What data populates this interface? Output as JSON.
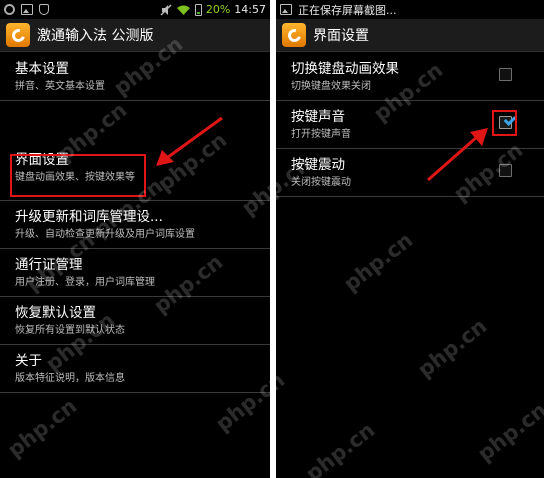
{
  "left_screen": {
    "status_bar": {
      "battery_percent": "20%",
      "time": "14:57"
    },
    "title": "激通输入法 公测版",
    "menu_items": [
      {
        "title": "基本设置",
        "subtitle": "拼音、英文基本设置"
      },
      {
        "title": "界面设置",
        "subtitle": "键盘动画效果、按键效果等"
      },
      {
        "title": "升级更新和词库管理设...",
        "subtitle": "升级、自动检查更新升级及用户词库设置"
      },
      {
        "title": "通行证管理",
        "subtitle": "用户注册、登录，用户词库管理"
      },
      {
        "title": "恢复默认设置",
        "subtitle": "恢复所有设置到默认状态"
      },
      {
        "title": "关于",
        "subtitle": "版本特征说明，版本信息"
      }
    ]
  },
  "right_screen": {
    "status_bar": {
      "notification_text": "正在保存屏幕截图..."
    },
    "title": "界面设置",
    "settings": [
      {
        "title": "切换键盘动画效果",
        "subtitle": "切换键盘效果关闭",
        "checked": false
      },
      {
        "title": "按键声音",
        "subtitle": "打开按键声音",
        "checked": true
      },
      {
        "title": "按键震动",
        "subtitle": "关闭按键震动",
        "checked": false
      }
    ]
  },
  "watermark_text": "php.cn",
  "colors": {
    "highlight": "#e01616",
    "checkmark": "#3aa4e8",
    "battery": "#8fd020",
    "app_icon": "#f29a10"
  }
}
